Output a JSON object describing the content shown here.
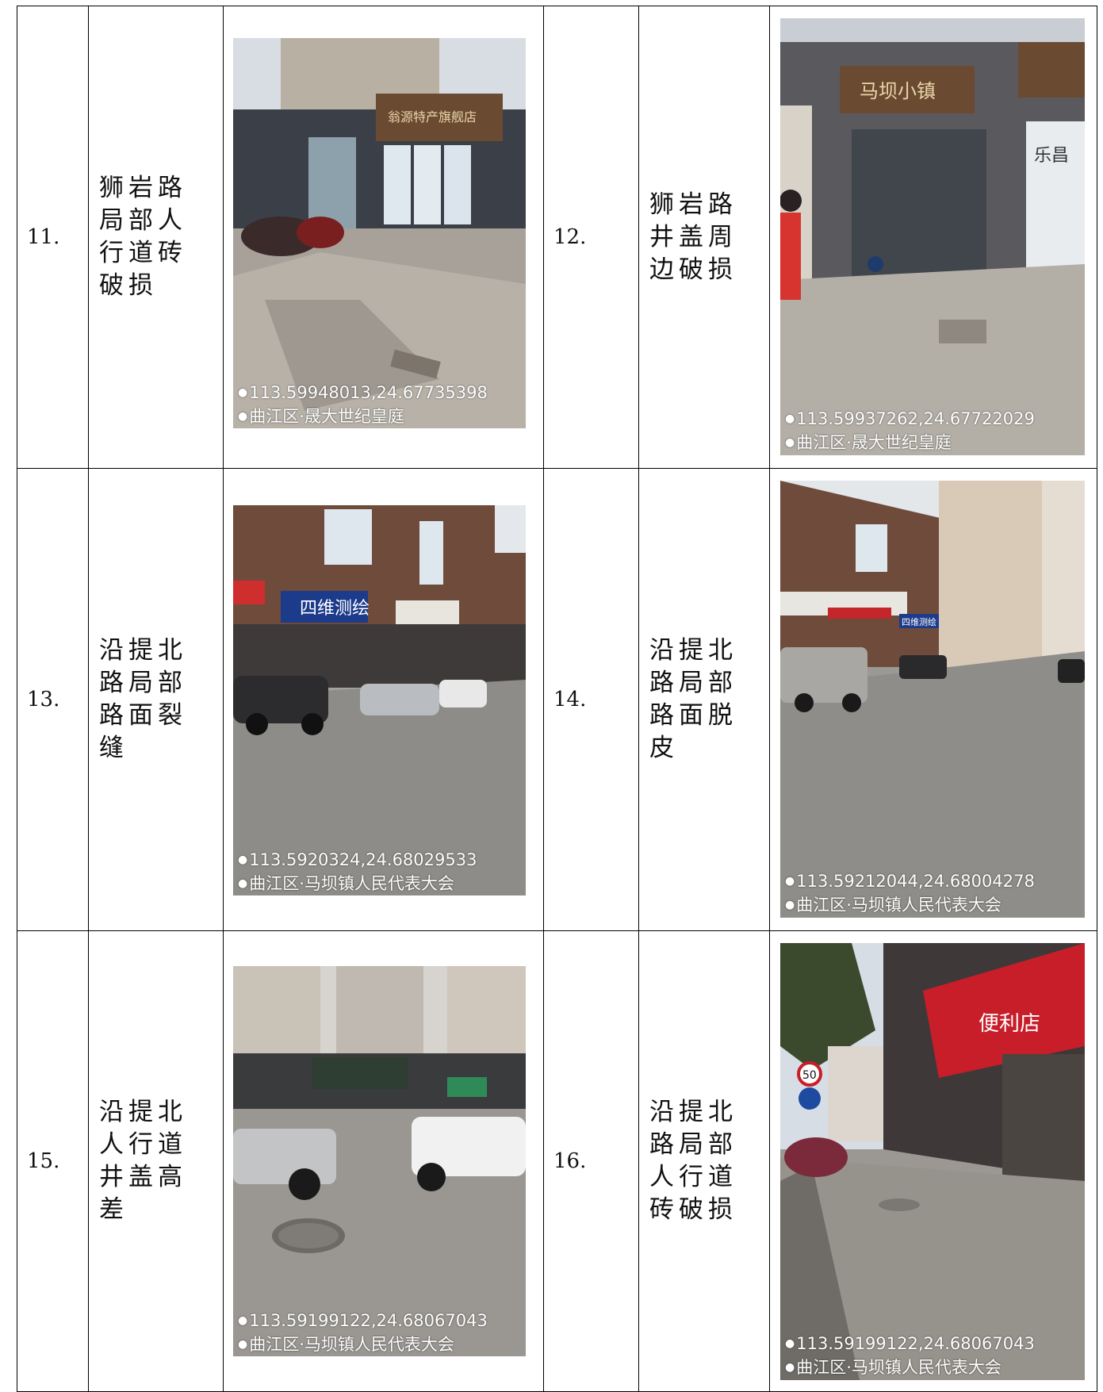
{
  "rows": [
    {
      "left": {
        "num": "11.",
        "desc": "狮岩路局部人行道砖破损",
        "coords": "113.59948013,24.67735398",
        "place": "曲江区·晟大世纪皇庭",
        "image": "photo of shopfronts on 狮岩路 with parked scooters and damaged pavement tiles",
        "signs": [
          "翁源特产旗舰店"
        ]
      },
      "right": {
        "num": "12.",
        "desc": "狮岩路井盖周边破损",
        "coords": "113.59937262,24.67722029",
        "place": "曲江区·晟大世纪皇庭",
        "image": "photo of shop entrance on 狮岩路 with damaged pavement around manhole cover",
        "signs": [
          "马坝小镇",
          "乐昌"
        ]
      }
    },
    {
      "left": {
        "num": "13.",
        "desc": "沿提北路局部路面裂缝",
        "coords": "113.5920324,24.68029533",
        "place": "曲江区·马坝镇人民代表大会",
        "image": "photo of street on 沿提北路 with parked cars and cracked road surface",
        "signs": [
          "四维测绘"
        ]
      },
      "right": {
        "num": "14.",
        "desc": "沿提北路局部路面脱皮",
        "coords": "113.59212044,24.68004278",
        "place": "曲江区·马坝镇人民代表大会",
        "image": "photo of street on 沿提北路 with parked cars and peeling road surface",
        "signs": [
          "四维测绘"
        ]
      }
    },
    {
      "left": {
        "num": "15.",
        "desc": "沿提北人行道井盖高差",
        "coords": "113.59199122,24.68067043",
        "place": "曲江区·马坝镇人民代表大会",
        "image": "photo of sidewalk on 沿提北路 with manhole cover height difference and cars",
        "signs": []
      },
      "right": {
        "num": "16.",
        "desc": "沿提北路局部人行道砖破损",
        "coords": "113.59199122,24.68067043",
        "place": "曲江区·马坝镇人民代表大会",
        "image": "photo of sidewalk on 沿提北路 with shopfronts and damaged paving tiles",
        "signs": [
          "便利店",
          "50"
        ]
      }
    }
  ]
}
